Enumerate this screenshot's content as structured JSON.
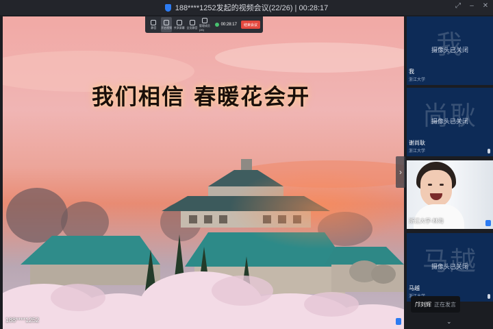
{
  "window": {
    "title": "188****1252发起的视频会议(22/26) | 00:28:17"
  },
  "toolbar": {
    "buttons": [
      {
        "label": "静音"
      },
      {
        "label": "开启视频"
      },
      {
        "label": "共享屏幕"
      },
      {
        "label": "全员静音"
      },
      {
        "label": "管理成员(26)"
      }
    ],
    "timer": "00:28:17",
    "leave_label": "结束会议"
  },
  "stage": {
    "slogan": "我们相信 春暖花会开",
    "participant_name": "188****1252"
  },
  "participants": [
    {
      "big": "我",
      "status": "摄像头已关闭",
      "name": "我",
      "org": "浙江大学"
    },
    {
      "big": "尚耿",
      "status": "摄像头已关闭",
      "name": "谢尚耿",
      "org": "浙江大学"
    },
    {
      "name": "浙江大学-林海"
    },
    {
      "big": "马越",
      "status": "摄像头已关闭",
      "name": "马越",
      "org": "浙江大学"
    }
  ],
  "speaking": {
    "who": "邝刘辉",
    "state": "正在发言"
  },
  "colors": {
    "tile_bg": "#0d2b57",
    "leave_red": "#e4493f",
    "accent_blue": "#2c7bf2"
  }
}
